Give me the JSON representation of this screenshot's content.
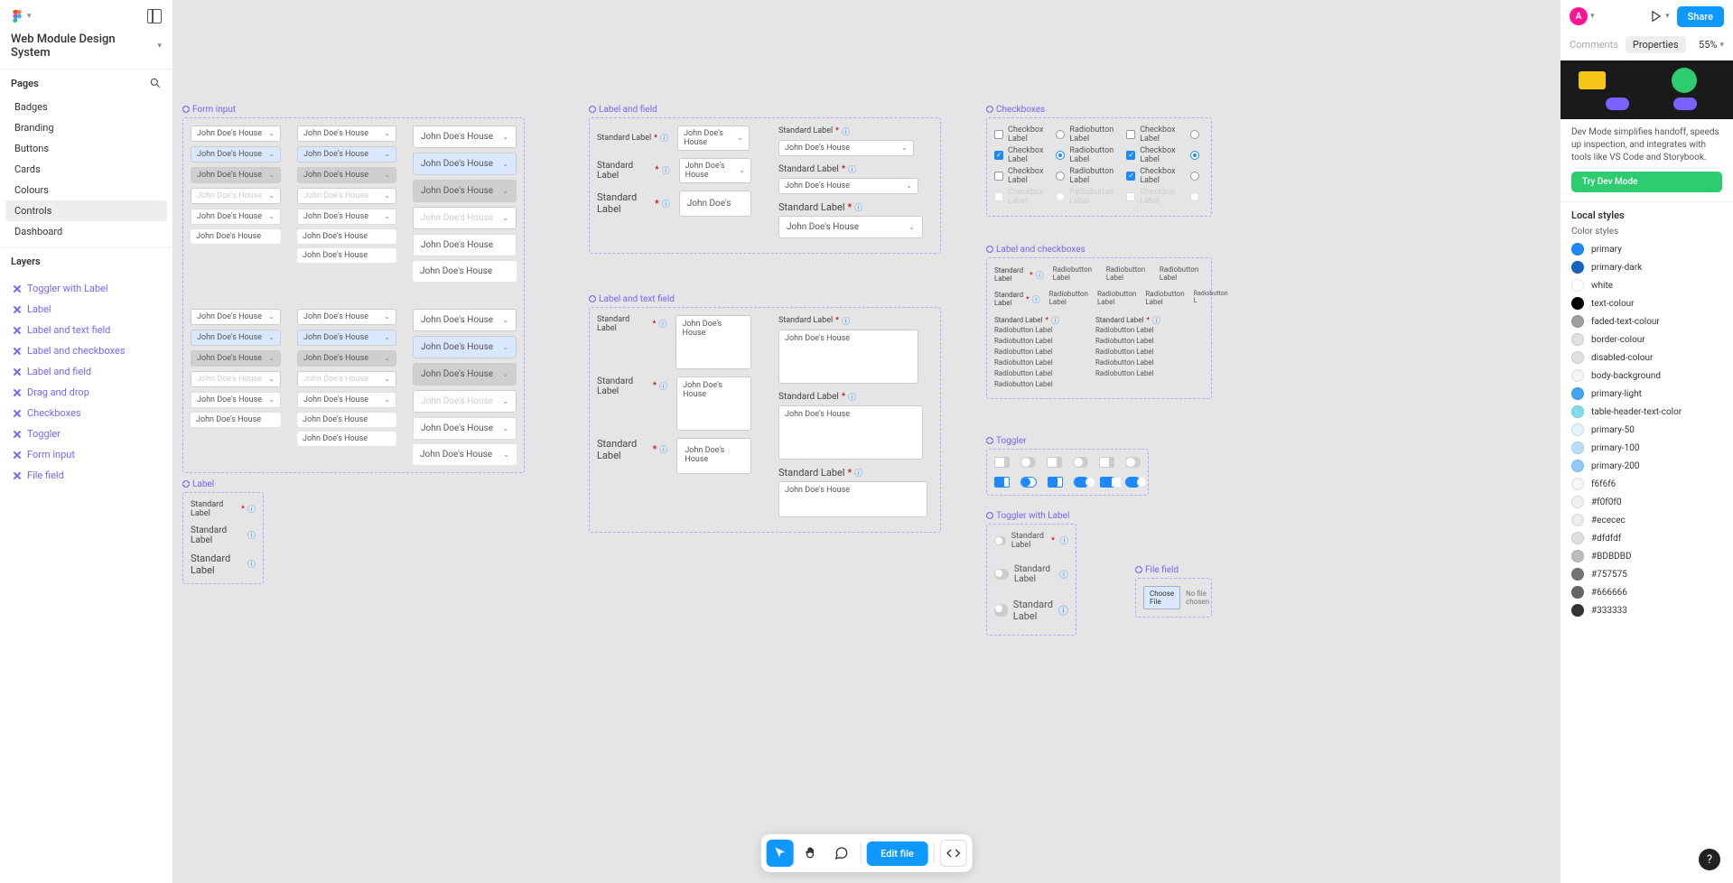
{
  "file_title": "Web Module Design System",
  "sections": {
    "pages": "Pages",
    "layers": "Layers"
  },
  "pages": [
    "Badges",
    "Branding",
    "Buttons",
    "Cards",
    "Colours",
    "Controls",
    "Dashboard"
  ],
  "pages_active": "Controls",
  "layers": [
    "Toggler with Label",
    "Label",
    "Label and text field",
    "Label and checkboxes",
    "Label and field",
    "Drag and drop",
    "Checkboxes",
    "Toggler",
    "Form input",
    "File field"
  ],
  "frames": {
    "form_input": "Form input",
    "label": "Label",
    "label_and_field": "Label and field",
    "label_and_text_field": "Label and text field",
    "checkboxes": "Checkboxes",
    "label_and_checkboxes": "Label and checkboxes",
    "toggler": "Toggler",
    "toggler_with_label": "Toggler with Label",
    "file_field": "File field"
  },
  "sample_text": "John Doe's House",
  "sample_text_short": "John Doe's",
  "label_text": "Standard Label",
  "checkbox_label": "Checkbox Label",
  "radio_label": "Radiobutton Label",
  "radio_short": "Ra",
  "file_btn": "Choose File",
  "file_none": "No file chosen",
  "right": {
    "avatar": "A",
    "share": "Share",
    "tabs": {
      "comments": "Comments",
      "properties": "Properties"
    },
    "zoom": "55%",
    "dev_desc": "Dev Mode simplifies handoff, speeds up inspection, and integrates with tools like VS Code and Storybook.",
    "dev_btn": "Try Dev Mode",
    "local_styles": "Local styles",
    "color_styles": "Color styles"
  },
  "colors": [
    {
      "name": "primary",
      "hex": "#1e88ff"
    },
    {
      "name": "primary-dark",
      "hex": "#1565c0"
    },
    {
      "name": "white",
      "hex": "#ffffff"
    },
    {
      "name": "text-colour",
      "hex": "#000000"
    },
    {
      "name": "faded-text-colour",
      "hex": "#9e9e9e"
    },
    {
      "name": "border-colour",
      "hex": "#e0e0e0"
    },
    {
      "name": "disabled-colour",
      "hex": "#e0e0e0"
    },
    {
      "name": "body-background",
      "hex": "#f5f5f5"
    },
    {
      "name": "primary-light",
      "hex": "#42a5f5"
    },
    {
      "name": "table-header-text-color",
      "hex": "#80deea"
    },
    {
      "name": "primary-50",
      "hex": "#e3f2fd"
    },
    {
      "name": "primary-100",
      "hex": "#bbdefb"
    },
    {
      "name": "primary-200",
      "hex": "#90caf9"
    },
    {
      "name": "f6f6f6",
      "hex": "#f6f6f6"
    },
    {
      "name": "#f0f0f0",
      "hex": "#f0f0f0"
    },
    {
      "name": "#ececec",
      "hex": "#ececec"
    },
    {
      "name": "#dfdfdf",
      "hex": "#dfdfdf"
    },
    {
      "name": "#BDBDBD",
      "hex": "#BDBDBD"
    },
    {
      "name": "#757575",
      "hex": "#757575"
    },
    {
      "name": "#666666",
      "hex": "#666666"
    },
    {
      "name": "#333333",
      "hex": "#333333"
    }
  ],
  "bottom_bar": {
    "edit": "Edit file"
  }
}
